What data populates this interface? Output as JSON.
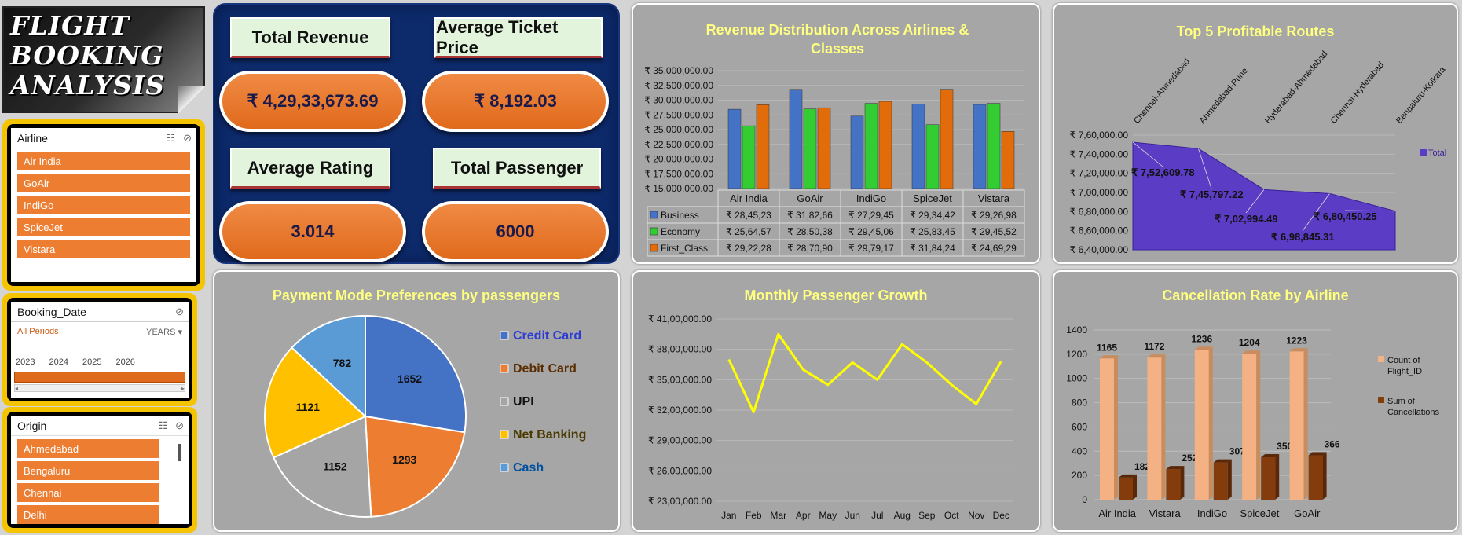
{
  "header": {
    "title_lines": [
      "FLIGHT",
      "BOOKING",
      "ANALYSIS"
    ]
  },
  "slicers": {
    "airline": {
      "title": "Airline",
      "items": [
        "Air India",
        "GoAir",
        "IndiGo",
        "SpiceJet",
        "Vistara"
      ]
    },
    "booking_date": {
      "title": "Booking_Date",
      "period_label": "All Periods",
      "level_label": "YEARS",
      "years": [
        "2023",
        "2024",
        "2025",
        "2026"
      ]
    },
    "origin": {
      "title": "Origin",
      "items": [
        "Ahmedabad",
        "Bengaluru",
        "Chennai",
        "Delhi"
      ]
    }
  },
  "kpis": {
    "total_revenue": {
      "label": "Total Revenue",
      "value": "₹ 4,29,33,673.69"
    },
    "avg_ticket_price": {
      "label": "Average Ticket Price",
      "value": "₹ 8,192.03"
    },
    "avg_rating": {
      "label": "Average Rating",
      "value": "3.014"
    },
    "total_passenger": {
      "label": "Total Passenger",
      "value": "6000"
    }
  },
  "colors": {
    "business": "#4472c4",
    "economy": "#33cc33",
    "first_class": "#e36c0a",
    "accent_title": "#ffff80",
    "kpi_bg": "#0d2a6b",
    "kpi_orange": "#ed7d31"
  },
  "chart_data": [
    {
      "id": "revenue",
      "type": "bar",
      "title": "Revenue Distribution Across Airlines & Classes",
      "categories": [
        "Air India",
        "GoAir",
        "IndiGo",
        "SpiceJet",
        "Vistara"
      ],
      "yticks": [
        "₹ 15,000,000.00",
        "₹ 17,500,000.00",
        "₹ 20,000,000.00",
        "₹ 22,500,000.00",
        "₹ 25,000,000.00",
        "₹ 27,500,000.00",
        "₹ 30,000,000.00",
        "₹ 32,500,000.00",
        "₹ 35,000,000.00"
      ],
      "ylim": [
        15000000,
        35000000
      ],
      "series": [
        {
          "name": "Business",
          "values": [
            2845230,
            3182660,
            2729450,
            2934420,
            2926980
          ],
          "labels": [
            "₹ 28,45,23",
            "₹ 31,82,66",
            "₹ 27,29,45",
            "₹ 29,34,42",
            "₹ 29,26,98"
          ],
          "color": "#4472c4"
        },
        {
          "name": "Economy",
          "values": [
            2564570,
            2850380,
            2945060,
            2583450,
            2945520
          ],
          "labels": [
            "₹ 25,64,57",
            "₹ 28,50,38",
            "₹ 29,45,06",
            "₹ 25,83,45",
            "₹ 29,45,52"
          ],
          "color": "#33cc33"
        },
        {
          "name": "First_Class",
          "values": [
            2922280,
            2870900,
            2979170,
            3184240,
            2469290
          ],
          "labels": [
            "₹ 29,22,28",
            "₹ 28,70,90",
            "₹ 29,79,17",
            "₹ 31,84,24",
            "₹ 24,69,29"
          ],
          "color": "#e36c0a"
        }
      ]
    },
    {
      "id": "routes",
      "type": "area",
      "title": "Top 5 Profitable Routes",
      "categories": [
        "Chennai-Ahmedabad",
        "Ahmedabad-Pune",
        "Hyderabad-Ahmedabad",
        "Chennai-Hyderabad",
        "Bengaluru-Kolkata"
      ],
      "values": [
        752609.78,
        745797.22,
        702994.49,
        698845.31,
        680450.25
      ],
      "labels": [
        "₹ 7,52,609.78",
        "₹ 7,45,797.22",
        "₹ 7,02,994.49",
        "₹ 6,98,845.31",
        "₹ 6,80,450.25"
      ],
      "yticks": [
        "₹ 6,40,000.00",
        "₹ 6,60,000.00",
        "₹ 6,80,000.00",
        "₹ 7,00,000.00",
        "₹ 7,20,000.00",
        "₹ 7,40,000.00",
        "₹ 7,60,000.00"
      ],
      "ylim": [
        640000,
        760000
      ],
      "legend": "Total",
      "color": "#5b3cc4"
    },
    {
      "id": "payment",
      "type": "pie",
      "title": "Payment Mode Preferences by passengers",
      "labels": [
        "Credit Card",
        "Debit Card",
        "UPI",
        "Net Banking",
        "Cash"
      ],
      "values": [
        1652,
        1293,
        1152,
        1121,
        782
      ],
      "colors": [
        "#4472c4",
        "#ed7d31",
        "#a5a5a5",
        "#ffc000",
        "#5b9bd5"
      ],
      "legend_colors": [
        "#2b3bd4",
        "#5a2c00",
        "#111111",
        "#4a3a00",
        "#0050a0"
      ]
    },
    {
      "id": "monthly",
      "type": "line",
      "title": "Monthly Passenger Growth",
      "categories": [
        "Jan",
        "Feb",
        "Mar",
        "Apr",
        "May",
        "Jun",
        "Jul",
        "Aug",
        "Sep",
        "Oct",
        "Nov",
        "Dec"
      ],
      "values": [
        3700000,
        3180000,
        3950000,
        3600000,
        3450000,
        3670000,
        3500000,
        3850000,
        3670000,
        3450000,
        3260000,
        3680000
      ],
      "yticks": [
        "₹ 23,00,000.00",
        "₹ 26,00,000.00",
        "₹ 29,00,000.00",
        "₹ 32,00,000.00",
        "₹ 35,00,000.00",
        "₹ 38,00,000.00",
        "₹ 41,00,000.00"
      ],
      "ylim": [
        2300000,
        4100000
      ],
      "color": "#ffff00"
    },
    {
      "id": "cancellation",
      "type": "bar",
      "title": "Cancellation Rate by Airline",
      "categories": [
        "Air India",
        "Vistara",
        "IndiGo",
        "SpiceJet",
        "GoAir"
      ],
      "yticks": [
        "0",
        "200",
        "400",
        "600",
        "800",
        "1000",
        "1200",
        "1400"
      ],
      "ylim": [
        0,
        1400
      ],
      "series": [
        {
          "name": "Count of Flight_ID",
          "values": [
            1165,
            1172,
            1236,
            1204,
            1223
          ],
          "color": "#f4b183"
        },
        {
          "name": "Sum of Cancellations",
          "values": [
            182,
            252,
            307,
            350,
            366
          ],
          "color": "#843c0c"
        }
      ],
      "legend": [
        "Count of Flight_ID",
        "Sum of Cancellations"
      ]
    }
  ]
}
